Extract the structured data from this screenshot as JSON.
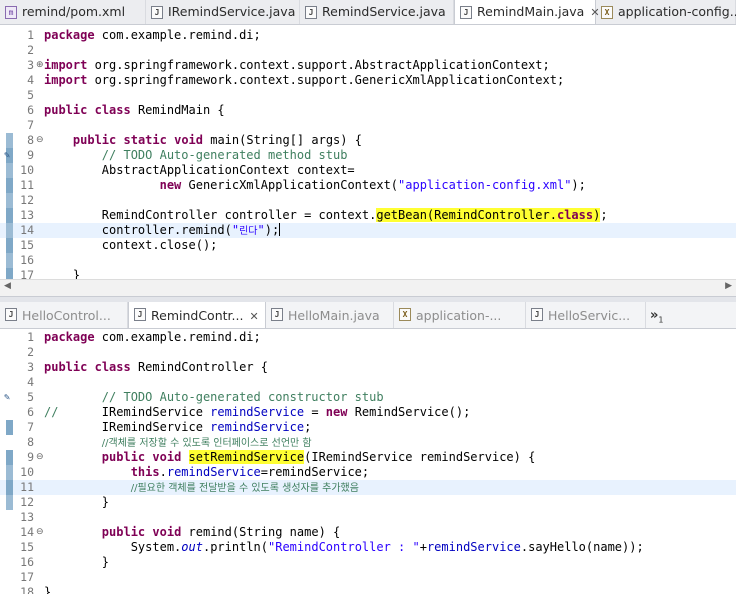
{
  "top_tabs": [
    {
      "label": "remind/pom.xml",
      "icon": "maven-pom-icon",
      "active": false
    },
    {
      "label": "IRemindService.java",
      "icon": "java-file-icon",
      "active": false
    },
    {
      "label": "RemindService.java",
      "icon": "java-file-icon",
      "active": false
    },
    {
      "label": "RemindMain.java",
      "icon": "java-file-icon",
      "active": true,
      "close": "✕"
    },
    {
      "label": "application-config....",
      "icon": "xml-file-icon",
      "active": false
    }
  ],
  "bottom_tabs": [
    {
      "label": "HelloControl...",
      "icon": "java-file-icon",
      "active": false
    },
    {
      "label": "RemindContr...",
      "icon": "java-file-icon",
      "active": true,
      "close": "✕"
    },
    {
      "label": "HelloMain.java",
      "icon": "java-file-icon",
      "active": false
    },
    {
      "label": "application-...",
      "icon": "xml-file-icon",
      "active": false
    },
    {
      "label": "HelloServic...",
      "icon": "java-file-icon",
      "active": false
    }
  ],
  "overflow_indicator": {
    "symbol": "»",
    "count": "1"
  },
  "top_editor": {
    "lines": [
      {
        "n": "1",
        "segs": [
          [
            "k",
            "package"
          ],
          [
            "p",
            " com.example.remind.di;"
          ]
        ]
      },
      {
        "n": "2",
        "segs": []
      },
      {
        "n": "3",
        "fold": "⊕",
        "segs": [
          [
            "k",
            "import"
          ],
          [
            "p",
            " org.springframework.context.support.AbstractApplicationContext;"
          ]
        ]
      },
      {
        "n": "4",
        "segs": [
          [
            "k",
            "import"
          ],
          [
            "p",
            " org.springframework.context.support.GenericXmlApplicationContext;"
          ]
        ]
      },
      {
        "n": "5",
        "segs": []
      },
      {
        "n": "6",
        "segs": [
          [
            "k",
            "public"
          ],
          [
            "p",
            " "
          ],
          [
            "k",
            "class"
          ],
          [
            "p",
            " RemindMain {"
          ]
        ]
      },
      {
        "n": "7",
        "segs": []
      },
      {
        "n": "8",
        "fold": "⊖",
        "change": true,
        "segs": [
          [
            "p",
            "    "
          ],
          [
            "k",
            "public"
          ],
          [
            "p",
            " "
          ],
          [
            "k",
            "static"
          ],
          [
            "p",
            " "
          ],
          [
            "k",
            "void"
          ],
          [
            "p",
            " main(String[] args) {"
          ]
        ]
      },
      {
        "n": "9",
        "change": true,
        "task": true,
        "segs": [
          [
            "p",
            "        "
          ],
          [
            "c",
            "// TODO Auto-generated method stub"
          ]
        ]
      },
      {
        "n": "10",
        "change": true,
        "segs": [
          [
            "p",
            "        AbstractApplicationContext context="
          ]
        ]
      },
      {
        "n": "11",
        "change": true,
        "segs": [
          [
            "p",
            "                "
          ],
          [
            "k",
            "new"
          ],
          [
            "p",
            " GenericXmlApplicationContext("
          ],
          [
            "s",
            "\"application-config.xml\""
          ],
          [
            "p",
            ");"
          ]
        ]
      },
      {
        "n": "12",
        "change": true,
        "segs": []
      },
      {
        "n": "13",
        "change": true,
        "segs": [
          [
            "p",
            "        RemindController controller = context."
          ],
          [
            "hl",
            "getBean(RemindController."
          ],
          [
            "hlk",
            "class"
          ],
          [
            "hl",
            ")"
          ],
          [
            "p",
            ";"
          ]
        ]
      },
      {
        "n": "14",
        "change": true,
        "current": true,
        "segs": [
          [
            "p",
            "        controller.remind("
          ],
          [
            "s",
            "\""
          ],
          [
            "sko",
            "린다"
          ],
          [
            "s",
            "\""
          ],
          [
            "p",
            ");"
          ]
        ]
      },
      {
        "n": "15",
        "change": true,
        "segs": [
          [
            "p",
            "        context.close();"
          ]
        ]
      },
      {
        "n": "16",
        "change": true,
        "segs": []
      },
      {
        "n": "17",
        "change": true,
        "segs": [
          [
            "p",
            "    }"
          ]
        ]
      }
    ]
  },
  "bottom_editor": {
    "lines": [
      {
        "n": "1",
        "segs": [
          [
            "k",
            "package"
          ],
          [
            "p",
            " com.example.remind.di;"
          ]
        ]
      },
      {
        "n": "2",
        "segs": []
      },
      {
        "n": "3",
        "segs": [
          [
            "k",
            "public"
          ],
          [
            "p",
            " "
          ],
          [
            "k",
            "class"
          ],
          [
            "p",
            " RemindController {"
          ]
        ]
      },
      {
        "n": "4",
        "segs": []
      },
      {
        "n": "5",
        "task": true,
        "segs": [
          [
            "p",
            "        "
          ],
          [
            "c",
            "// TODO Auto-generated constructor stub"
          ]
        ]
      },
      {
        "n": "6",
        "segs": [
          [
            "c",
            "//"
          ],
          [
            "p",
            "      IRemindService "
          ],
          [
            "f",
            "remindService"
          ],
          [
            "p",
            " = "
          ],
          [
            "k",
            "new"
          ],
          [
            "p",
            " RemindService();"
          ]
        ]
      },
      {
        "n": "7",
        "change": true,
        "segs": [
          [
            "p",
            "        IRemindService "
          ],
          [
            "f",
            "remindService"
          ],
          [
            "p",
            ";"
          ]
        ]
      },
      {
        "n": "8",
        "segs": [
          [
            "p",
            "        "
          ],
          [
            "cko",
            "//객체를 저장할 수 있도록 인터페이스로 선언만 함"
          ]
        ]
      },
      {
        "n": "9",
        "fold": "⊖",
        "change": true,
        "segs": [
          [
            "p",
            "        "
          ],
          [
            "k",
            "public"
          ],
          [
            "p",
            " "
          ],
          [
            "k",
            "void"
          ],
          [
            "p",
            " "
          ],
          [
            "hl",
            "setRemindService"
          ],
          [
            "p",
            "(IRemindService remindService) {"
          ]
        ]
      },
      {
        "n": "10",
        "change": true,
        "segs": [
          [
            "p",
            "            "
          ],
          [
            "k",
            "this"
          ],
          [
            "p",
            "."
          ],
          [
            "f",
            "remindService"
          ],
          [
            "p",
            "=remindService;"
          ]
        ]
      },
      {
        "n": "11",
        "change": true,
        "current": true,
        "segs": [
          [
            "p",
            "            "
          ],
          [
            "cko",
            "//필요한 객체를 전달받을 수 있도록 생성자를 추가했음"
          ]
        ]
      },
      {
        "n": "12",
        "change": true,
        "segs": [
          [
            "p",
            "        }"
          ]
        ]
      },
      {
        "n": "13",
        "segs": []
      },
      {
        "n": "14",
        "fold": "⊖",
        "segs": [
          [
            "p",
            "        "
          ],
          [
            "k",
            "public"
          ],
          [
            "p",
            " "
          ],
          [
            "k",
            "void"
          ],
          [
            "p",
            " remind(String name) {"
          ]
        ]
      },
      {
        "n": "15",
        "segs": [
          [
            "p",
            "            System."
          ],
          [
            "fi",
            "out"
          ],
          [
            "p",
            ".println("
          ],
          [
            "s",
            "\"RemindController : \""
          ],
          [
            "p",
            "+"
          ],
          [
            "f",
            "remindService"
          ],
          [
            "p",
            ".sayHello(name));"
          ]
        ]
      },
      {
        "n": "16",
        "segs": [
          [
            "p",
            "        }"
          ]
        ]
      },
      {
        "n": "17",
        "segs": []
      },
      {
        "n": "18",
        "segs": [
          [
            "p",
            "}"
          ]
        ]
      }
    ]
  },
  "colors": {
    "keyword": "#7f0055",
    "comment": "#3f7f5f",
    "string": "#2a00ff",
    "field": "#0000c0",
    "highlight": "#ffff33",
    "current_line": "#e8f2fe",
    "change_bar": "#7fa8c7"
  }
}
